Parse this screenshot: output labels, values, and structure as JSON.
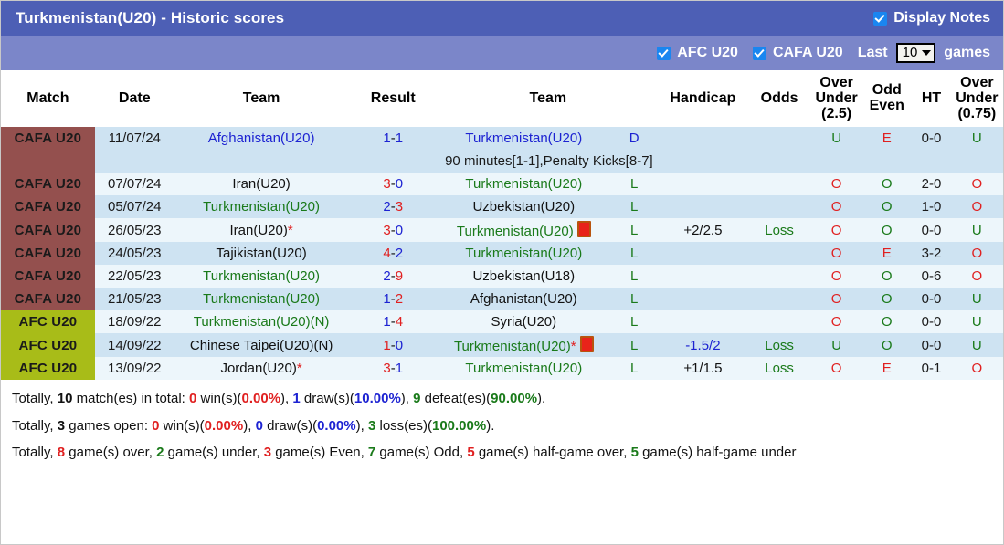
{
  "header": {
    "title": "Turkmenistan(U20) - Historic scores",
    "display_notes_label": "Display Notes",
    "display_notes_checked": true,
    "accent_title_bg": "#4d5fb5",
    "accent_filter_bg": "#7b86c9"
  },
  "filters": {
    "afc_label": "AFC U20",
    "afc_checked": true,
    "cafa_label": "CAFA U20",
    "cafa_checked": true,
    "last_label": "Last",
    "games_label": "games",
    "count_value": "10"
  },
  "columns": {
    "match": "Match",
    "date": "Date",
    "team_home": "Team",
    "result": "Result",
    "team_away": "Team",
    "handicap": "Handicap",
    "odds": "Odds",
    "over_under_25_l1": "Over",
    "over_under_25_l2": "Under",
    "over_under_25_l3": "(2.5)",
    "odd_even_l1": "Odd",
    "odd_even_l2": "Even",
    "ht": "HT",
    "over_under_075_l1": "Over",
    "over_under_075_l2": "Under",
    "over_under_075_l3": "(0.75)"
  },
  "rows": [
    {
      "badge": "CAFA U20",
      "badge_type": "cafa",
      "date": "11/07/24",
      "home": "Afghanistan(U20)",
      "home_color": "blue",
      "home_star": false,
      "score_home": "1",
      "score_away": "1",
      "score_home_color": "blue",
      "score_away_color": "blue",
      "away": "Turkmenistan(U20)",
      "away_color": "blue",
      "away_card": false,
      "away_star": false,
      "wl": "D",
      "wl_color": "blue",
      "handicap": "",
      "handicap_color": "black",
      "odds": "",
      "odds_color": "green",
      "ou25": "U",
      "ou25_color": "green",
      "oddeven": "E",
      "oddeven_color": "red",
      "ht": "0-0",
      "ou075": "U",
      "ou075_color": "green",
      "note": "90 minutes[1-1],Penalty Kicks[8-7]"
    },
    {
      "badge": "CAFA U20",
      "badge_type": "cafa",
      "date": "07/07/24",
      "home": "Iran(U20)",
      "home_color": "black",
      "home_star": false,
      "score_home": "3",
      "score_away": "0",
      "score_home_color": "red",
      "score_away_color": "blue",
      "away": "Turkmenistan(U20)",
      "away_color": "green",
      "away_card": false,
      "away_star": false,
      "wl": "L",
      "wl_color": "green",
      "handicap": "",
      "handicap_color": "black",
      "odds": "",
      "odds_color": "green",
      "ou25": "O",
      "ou25_color": "red",
      "oddeven": "O",
      "oddeven_color": "green",
      "ht": "2-0",
      "ou075": "O",
      "ou075_color": "red",
      "note": ""
    },
    {
      "badge": "CAFA U20",
      "badge_type": "cafa",
      "date": "05/07/24",
      "home": "Turkmenistan(U20)",
      "home_color": "green",
      "home_star": false,
      "score_home": "2",
      "score_away": "3",
      "score_home_color": "blue",
      "score_away_color": "red",
      "away": "Uzbekistan(U20)",
      "away_color": "black",
      "away_card": false,
      "away_star": false,
      "wl": "L",
      "wl_color": "green",
      "handicap": "",
      "handicap_color": "black",
      "odds": "",
      "odds_color": "green",
      "ou25": "O",
      "ou25_color": "red",
      "oddeven": "O",
      "oddeven_color": "green",
      "ht": "1-0",
      "ou075": "O",
      "ou075_color": "red",
      "note": ""
    },
    {
      "badge": "CAFA U20",
      "badge_type": "cafa",
      "date": "26/05/23",
      "home": "Iran(U20)",
      "home_color": "black",
      "home_star": true,
      "score_home": "3",
      "score_away": "0",
      "score_home_color": "red",
      "score_away_color": "blue",
      "away": "Turkmenistan(U20)",
      "away_color": "green",
      "away_card": true,
      "away_star": false,
      "wl": "L",
      "wl_color": "green",
      "handicap": "+2/2.5",
      "handicap_color": "black",
      "odds": "Loss",
      "odds_color": "green",
      "ou25": "O",
      "ou25_color": "red",
      "oddeven": "O",
      "oddeven_color": "green",
      "ht": "0-0",
      "ou075": "U",
      "ou075_color": "green",
      "note": ""
    },
    {
      "badge": "CAFA U20",
      "badge_type": "cafa",
      "date": "24/05/23",
      "home": "Tajikistan(U20)",
      "home_color": "black",
      "home_star": false,
      "score_home": "4",
      "score_away": "2",
      "score_home_color": "red",
      "score_away_color": "blue",
      "away": "Turkmenistan(U20)",
      "away_color": "green",
      "away_card": false,
      "away_star": false,
      "wl": "L",
      "wl_color": "green",
      "handicap": "",
      "handicap_color": "black",
      "odds": "",
      "odds_color": "green",
      "ou25": "O",
      "ou25_color": "red",
      "oddeven": "E",
      "oddeven_color": "red",
      "ht": "3-2",
      "ou075": "O",
      "ou075_color": "red",
      "note": ""
    },
    {
      "badge": "CAFA U20",
      "badge_type": "cafa",
      "date": "22/05/23",
      "home": "Turkmenistan(U20)",
      "home_color": "green",
      "home_star": false,
      "score_home": "2",
      "score_away": "9",
      "score_home_color": "blue",
      "score_away_color": "red",
      "away": "Uzbekistan(U18)",
      "away_color": "black",
      "away_card": false,
      "away_star": false,
      "wl": "L",
      "wl_color": "green",
      "handicap": "",
      "handicap_color": "black",
      "odds": "",
      "odds_color": "green",
      "ou25": "O",
      "ou25_color": "red",
      "oddeven": "O",
      "oddeven_color": "green",
      "ht": "0-6",
      "ou075": "O",
      "ou075_color": "red",
      "note": ""
    },
    {
      "badge": "CAFA U20",
      "badge_type": "cafa",
      "date": "21/05/23",
      "home": "Turkmenistan(U20)",
      "home_color": "green",
      "home_star": false,
      "score_home": "1",
      "score_away": "2",
      "score_home_color": "blue",
      "score_away_color": "red",
      "away": "Afghanistan(U20)",
      "away_color": "black",
      "away_card": false,
      "away_star": false,
      "wl": "L",
      "wl_color": "green",
      "handicap": "",
      "handicap_color": "black",
      "odds": "",
      "odds_color": "green",
      "ou25": "O",
      "ou25_color": "red",
      "oddeven": "O",
      "oddeven_color": "green",
      "ht": "0-0",
      "ou075": "U",
      "ou075_color": "green",
      "note": ""
    },
    {
      "badge": "AFC U20",
      "badge_type": "afc",
      "date": "18/09/22",
      "home": "Turkmenistan(U20)(N)",
      "home_color": "green",
      "home_star": false,
      "score_home": "1",
      "score_away": "4",
      "score_home_color": "blue",
      "score_away_color": "red",
      "away": "Syria(U20)",
      "away_color": "black",
      "away_card": false,
      "away_star": false,
      "wl": "L",
      "wl_color": "green",
      "handicap": "",
      "handicap_color": "black",
      "odds": "",
      "odds_color": "green",
      "ou25": "O",
      "ou25_color": "red",
      "oddeven": "O",
      "oddeven_color": "green",
      "ht": "0-0",
      "ou075": "U",
      "ou075_color": "green",
      "note": ""
    },
    {
      "badge": "AFC U20",
      "badge_type": "afc",
      "date": "14/09/22",
      "home": "Chinese Taipei(U20)(N)",
      "home_color": "black",
      "home_star": false,
      "score_home": "1",
      "score_away": "0",
      "score_home_color": "red",
      "score_away_color": "blue",
      "away": "Turkmenistan(U20)",
      "away_color": "green",
      "away_card": true,
      "away_star": true,
      "wl": "L",
      "wl_color": "green",
      "handicap": "-1.5/2",
      "handicap_color": "blue",
      "odds": "Loss",
      "odds_color": "green",
      "ou25": "U",
      "ou25_color": "green",
      "oddeven": "O",
      "oddeven_color": "green",
      "ht": "0-0",
      "ou075": "U",
      "ou075_color": "green",
      "note": ""
    },
    {
      "badge": "AFC U20",
      "badge_type": "afc",
      "date": "13/09/22",
      "home": "Jordan(U20)",
      "home_color": "black",
      "home_star": true,
      "score_home": "3",
      "score_away": "1",
      "score_home_color": "red",
      "score_away_color": "blue",
      "away": "Turkmenistan(U20)",
      "away_color": "green",
      "away_card": false,
      "away_star": false,
      "wl": "L",
      "wl_color": "green",
      "handicap": "+1/1.5",
      "handicap_color": "black",
      "odds": "Loss",
      "odds_color": "green",
      "ou25": "O",
      "ou25_color": "red",
      "oddeven": "E",
      "oddeven_color": "red",
      "ht": "0-1",
      "ou075": "O",
      "ou075_color": "red",
      "note": ""
    }
  ],
  "summary": {
    "line1": [
      {
        "t": "Totally, ",
        "c": "plain"
      },
      {
        "t": "10",
        "c": "black"
      },
      {
        "t": " match(es) in total: ",
        "c": "plain"
      },
      {
        "t": "0",
        "c": "red"
      },
      {
        "t": " win(s)(",
        "c": "plain"
      },
      {
        "t": "0.00%",
        "c": "red"
      },
      {
        "t": "), ",
        "c": "plain"
      },
      {
        "t": "1",
        "c": "blue"
      },
      {
        "t": " draw(s)(",
        "c": "plain"
      },
      {
        "t": "10.00%",
        "c": "blue"
      },
      {
        "t": "), ",
        "c": "plain"
      },
      {
        "t": "9",
        "c": "green"
      },
      {
        "t": " defeat(es)(",
        "c": "plain"
      },
      {
        "t": "90.00%",
        "c": "green"
      },
      {
        "t": ").",
        "c": "plain"
      }
    ],
    "line2": [
      {
        "t": "Totally, ",
        "c": "plain"
      },
      {
        "t": "3",
        "c": "black"
      },
      {
        "t": " games open: ",
        "c": "plain"
      },
      {
        "t": "0",
        "c": "red"
      },
      {
        "t": " win(s)(",
        "c": "plain"
      },
      {
        "t": "0.00%",
        "c": "red"
      },
      {
        "t": "), ",
        "c": "plain"
      },
      {
        "t": "0",
        "c": "blue"
      },
      {
        "t": " draw(s)(",
        "c": "plain"
      },
      {
        "t": "0.00%",
        "c": "blue"
      },
      {
        "t": "), ",
        "c": "plain"
      },
      {
        "t": "3",
        "c": "green"
      },
      {
        "t": " loss(es)(",
        "c": "plain"
      },
      {
        "t": "100.00%",
        "c": "green"
      },
      {
        "t": ").",
        "c": "plain"
      }
    ],
    "line3": [
      {
        "t": "Totally, ",
        "c": "plain"
      },
      {
        "t": "8",
        "c": "red"
      },
      {
        "t": " game(s) over, ",
        "c": "plain"
      },
      {
        "t": "2",
        "c": "green"
      },
      {
        "t": " game(s) under, ",
        "c": "plain"
      },
      {
        "t": "3",
        "c": "red"
      },
      {
        "t": " game(s) Even, ",
        "c": "plain"
      },
      {
        "t": "7",
        "c": "green"
      },
      {
        "t": " game(s) Odd, ",
        "c": "plain"
      },
      {
        "t": "5",
        "c": "red"
      },
      {
        "t": " game(s) half-game over, ",
        "c": "plain"
      },
      {
        "t": "5",
        "c": "green"
      },
      {
        "t": " game(s) half-game under",
        "c": "plain"
      }
    ]
  }
}
